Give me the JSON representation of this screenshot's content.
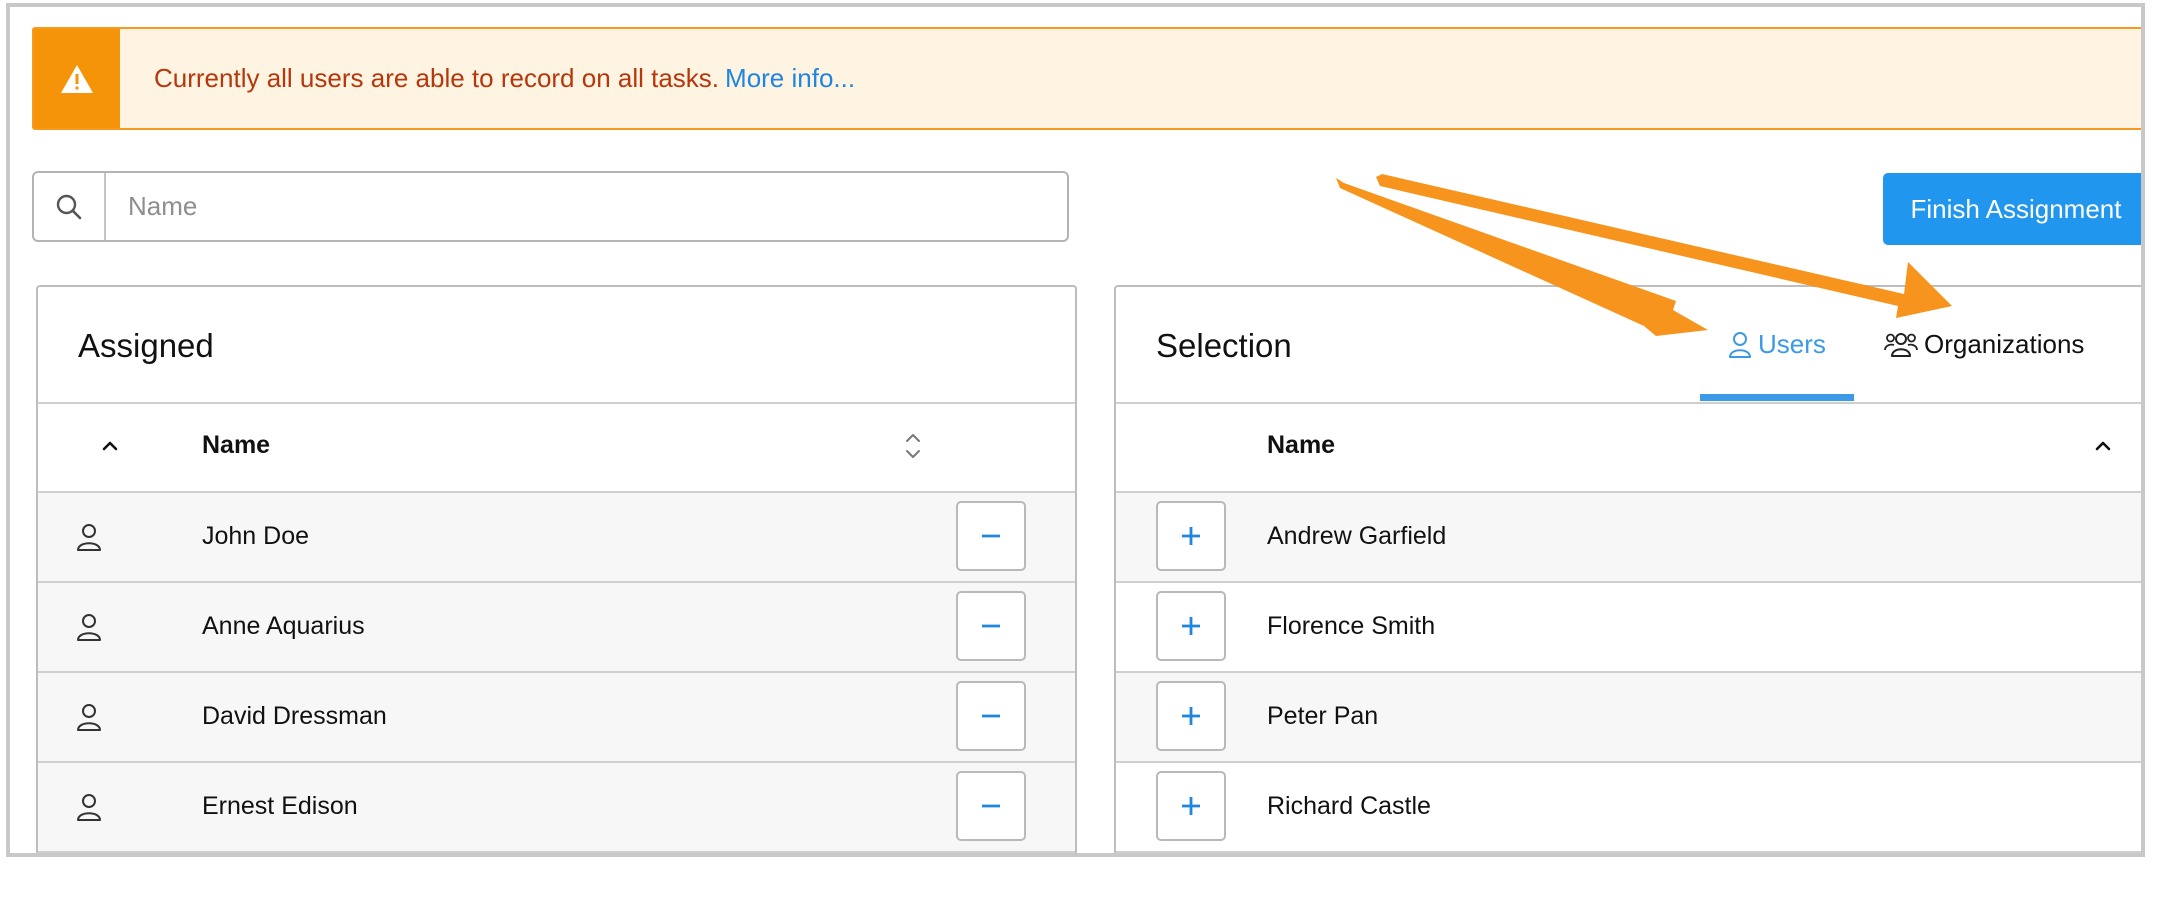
{
  "alert": {
    "message": "Currently all users are able to record on all tasks.",
    "link": "More info...",
    "icon": "warning-icon"
  },
  "search": {
    "placeholder": "Name",
    "value": "",
    "icon": "search-icon"
  },
  "toolbar": {
    "finish_label": "Finish Assignment"
  },
  "assigned": {
    "title": "Assigned",
    "columns": {
      "name": "Name"
    },
    "rows": [
      {
        "name": "John Doe"
      },
      {
        "name": "Anne Aquarius"
      },
      {
        "name": "David Dressman"
      },
      {
        "name": "Ernest Edison"
      }
    ]
  },
  "selection": {
    "title": "Selection",
    "tabs": [
      {
        "label": "Users",
        "active": true,
        "icon": "user-icon"
      },
      {
        "label": "Organizations",
        "active": false,
        "icon": "users-group-icon"
      }
    ],
    "columns": {
      "name": "Name"
    },
    "rows": [
      {
        "name": "Andrew Garfield"
      },
      {
        "name": "Florence Smith"
      },
      {
        "name": "Peter Pan"
      },
      {
        "name": "Richard Castle"
      }
    ]
  },
  "colors": {
    "accent": "#2196ee",
    "warning": "#f59408",
    "warning_text": "#b5370c",
    "annotation_arrow": "#f7941d"
  }
}
